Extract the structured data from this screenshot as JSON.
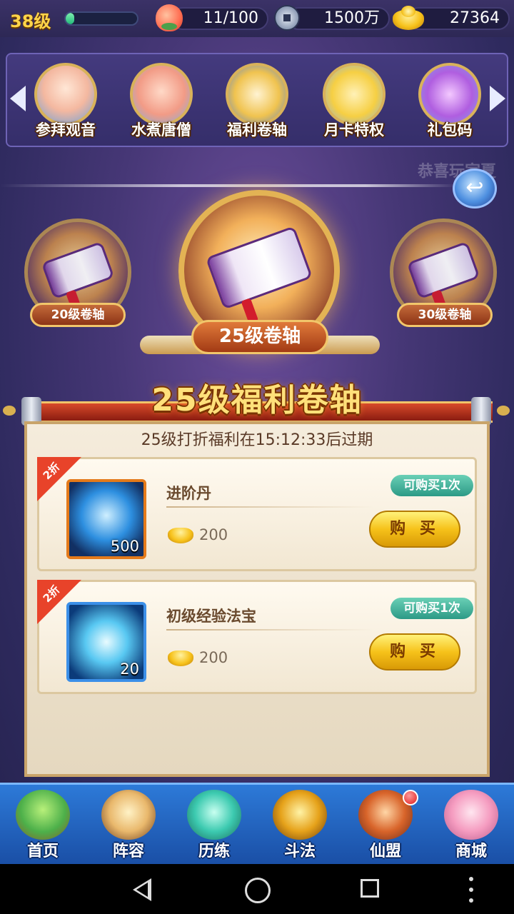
{
  "status_bar": {
    "level": "38级",
    "xp_fraction": 0.12,
    "stamina": "11/100",
    "silver": "1500万",
    "gold": "27364"
  },
  "activity_strip": {
    "items": [
      {
        "label": "参拜观音",
        "icon": "guanyin-portrait-icon"
      },
      {
        "label": "水煮唐僧",
        "icon": "tangseng-portrait-icon"
      },
      {
        "label": "福利卷轴",
        "icon": "scroll-bag-icon"
      },
      {
        "label": "月卡特权",
        "icon": "month-card-icon"
      },
      {
        "label": "礼包码",
        "icon": "gift-box-icon"
      }
    ]
  },
  "faded_text": "恭喜玩家夏",
  "scrolls": {
    "left_label": "20级卷轴",
    "center_label": "25级卷轴",
    "right_label": "30级卷轴"
  },
  "title": "25级福利卷轴",
  "expire_text": "25级打折福利在15:12:33后过期",
  "items": [
    {
      "discount": "2折",
      "name": "进阶丹",
      "quantity": "500",
      "price": "200",
      "limit": "可购买1次",
      "buy_label": "购 买",
      "icon": "blue-orb-icon"
    },
    {
      "discount": "2折",
      "name": "初级经验法宝",
      "quantity": "20",
      "price": "200",
      "limit": "可购买1次",
      "buy_label": "购 买",
      "icon": "exp-bottle-icon"
    }
  ],
  "bottom_nav": [
    {
      "label": "首页",
      "icon": "island-icon"
    },
    {
      "label": "阵容",
      "icon": "yinyang-formation-icon"
    },
    {
      "label": "历练",
      "icon": "gourd-icon"
    },
    {
      "label": "斗法",
      "icon": "helmet-icon"
    },
    {
      "label": "仙盟",
      "icon": "palace-icon"
    },
    {
      "label": "商城",
      "icon": "shop-girl-icon"
    }
  ]
}
